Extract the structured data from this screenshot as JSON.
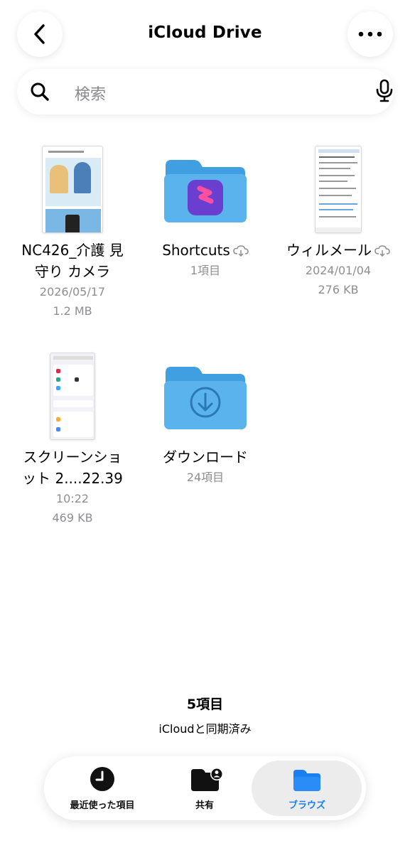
{
  "header": {
    "title": "iCloud Drive"
  },
  "search": {
    "placeholder": "検索"
  },
  "items": [
    {
      "name": "NC426_介護 見守り カメラ",
      "line1": "NC426_介護 見",
      "line2": "守り カメラ",
      "date": "2026/05/17",
      "size": "1.2 MB"
    },
    {
      "name": "Shortcuts",
      "count": "1項目"
    },
    {
      "name": "ウィルメール",
      "date": "2024/01/04",
      "size": "276 KB"
    },
    {
      "name": "スクリーンショット 2....22.39",
      "line1": "スクリーンショ",
      "line2": "ット 2....22.39",
      "date": "10:22",
      "size": "469 KB"
    },
    {
      "name": "ダウンロード",
      "count": "24項目"
    }
  ],
  "footer": {
    "count": "5項目",
    "sync_status": "iCloudと同期済み"
  },
  "tabs": [
    {
      "label": "最近使った項目",
      "icon": "clock-icon",
      "active": false
    },
    {
      "label": "共有",
      "icon": "shared-folder-icon",
      "active": false
    },
    {
      "label": "ブラウズ",
      "icon": "folder-icon",
      "active": true
    }
  ],
  "colors": {
    "accent": "#1a7ff0",
    "folder": "#5ab3ec",
    "secondary_text": "#8e8e93"
  }
}
